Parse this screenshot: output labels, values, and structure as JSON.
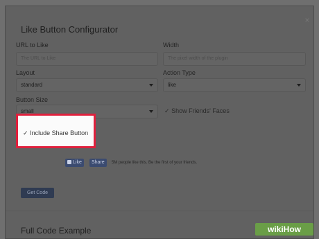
{
  "dialog": {
    "title": "Like Button Configurator",
    "close_glyph": "×",
    "close_icon": "close-icon"
  },
  "fields": {
    "url_label": "URL to Like",
    "url_placeholder": "The URL to Like",
    "width_label": "Width",
    "width_placeholder": "The pixel width of the plugin",
    "layout_label": "Layout",
    "layout_value": "standard",
    "action_label": "Action Type",
    "action_value": "like",
    "size_label": "Button Size",
    "size_value": "small"
  },
  "options": {
    "show_faces_check": "✓",
    "show_faces_label": "Show Friends' Faces",
    "share_check": "✓",
    "share_label": "Include Share Button"
  },
  "preview": {
    "like_label": "Like",
    "share_label": "Share",
    "social_text": "5M people like this. Be the first of your friends."
  },
  "actions": {
    "get_code_label": "Get Code"
  },
  "footer": {
    "section_title": "Full Code Example",
    "watermark": "wikiHow"
  },
  "colors": {
    "highlight_border": "#e0203d",
    "facebook_blue": "#3b4b70",
    "overlay": "#6f6f6f"
  }
}
